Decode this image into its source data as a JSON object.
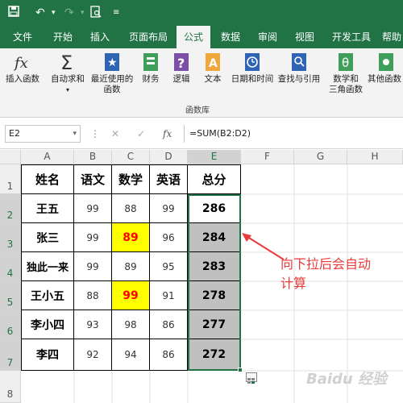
{
  "tabs": [
    "文件",
    "开始",
    "插入",
    "页面布局",
    "公式",
    "数据",
    "审阅",
    "视图",
    "开发工具",
    "帮助"
  ],
  "ribbon": {
    "buttons": [
      {
        "label": "插入函数",
        "label2": ""
      },
      {
        "label": "自动求和",
        "label2": ""
      },
      {
        "label": "最近使用的",
        "label2": "函数"
      },
      {
        "label": "财务",
        "label2": ""
      },
      {
        "label": "逻辑",
        "label2": ""
      },
      {
        "label": "文本",
        "label2": ""
      },
      {
        "label": "日期和时间",
        "label2": ""
      },
      {
        "label": "查找与引用",
        "label2": ""
      },
      {
        "label": "数学和",
        "label2": "三角函数"
      },
      {
        "label": "其他函数",
        "label2": ""
      }
    ],
    "group_label": "函数库"
  },
  "formula_bar": {
    "name_box": "E2",
    "fx": "fx",
    "formula": "=SUM(B2:D2)"
  },
  "columns": [
    "A",
    "B",
    "C",
    "D",
    "E",
    "F",
    "G",
    "H"
  ],
  "rows": [
    "1",
    "2",
    "3",
    "4",
    "5",
    "6",
    "7",
    "8"
  ],
  "table": {
    "headers": [
      "姓名",
      "语文",
      "数学",
      "英语",
      "总分"
    ],
    "data": [
      [
        "王五",
        "99",
        "88",
        "99",
        "286"
      ],
      [
        "张三",
        "99",
        "89",
        "96",
        "284"
      ],
      [
        "独此一来",
        "99",
        "89",
        "95",
        "283"
      ],
      [
        "王小五",
        "88",
        "99",
        "91",
        "278"
      ],
      [
        "李小四",
        "93",
        "98",
        "86",
        "277"
      ],
      [
        "李四",
        "92",
        "94",
        "86",
        "272"
      ]
    ]
  },
  "annotation": {
    "line1": "向下拉后会自动",
    "line2": "计算"
  },
  "watermark": "Baidu 经验",
  "colors": {
    "excel_green": "#217346",
    "highlight": "#ffff00",
    "highlight_text": "#ff0000",
    "annotation": "#e83a3a",
    "total_fill": "#c0c0c0"
  }
}
